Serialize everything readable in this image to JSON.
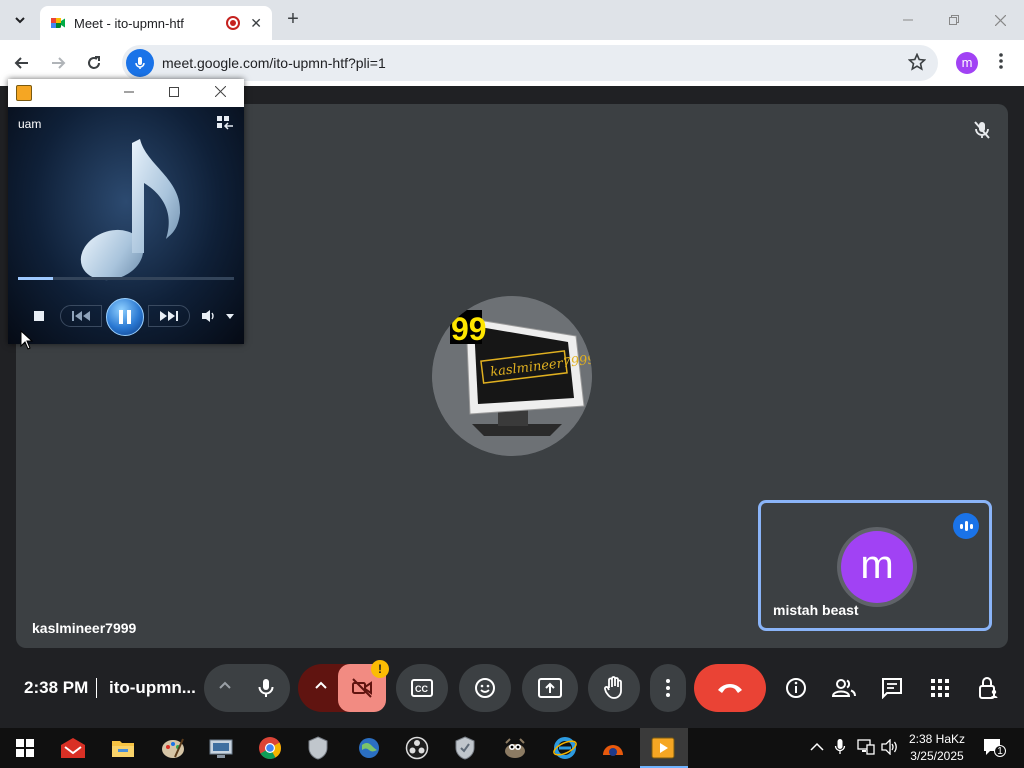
{
  "browser": {
    "tab_title": "Meet - ito-upmn-htf",
    "url": "meet.google.com/ito-upmn-htf?pli=1",
    "profile_initial": "m",
    "new_tab_symbol": "+",
    "close_tab_symbol": "✕"
  },
  "meeting": {
    "main_participant": "kaslmineer7999",
    "self_participant": "mistah beast",
    "self_initial": "m",
    "time": "2:38 PM",
    "code": "ito-upmn..."
  },
  "media_player": {
    "label": "uam",
    "progress": 0.16
  },
  "taskbar": {
    "time": "2:38 HaKz",
    "date": "3/25/2025",
    "notification_count": "1"
  },
  "colors": {
    "meet_bg": "#202124",
    "tile_bg": "#3c4043",
    "accent_blue": "#1a73e8",
    "end_call_red": "#ea4335",
    "avatar_purple": "#a142f4",
    "camera_off_pink": "#f28b82"
  }
}
